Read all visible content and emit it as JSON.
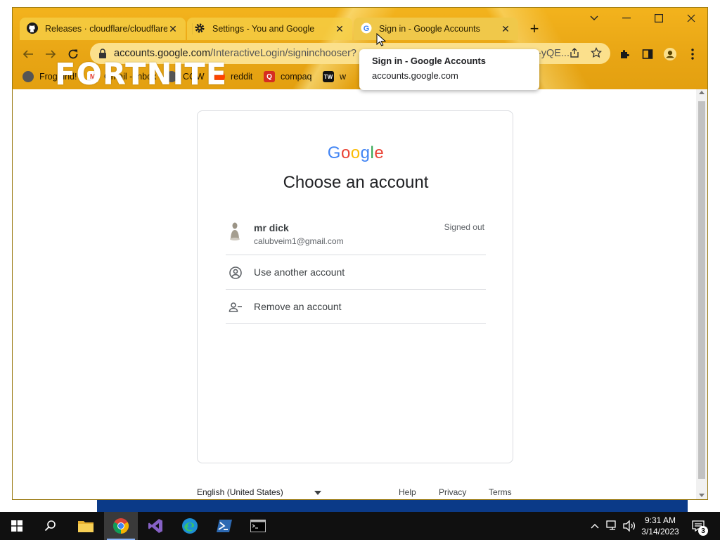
{
  "browser": {
    "tabs": [
      {
        "label": "Releases · cloudflare/cloudflared",
        "icon": "github-icon",
        "active": false
      },
      {
        "label": "Settings - You and Google",
        "icon": "gear-icon",
        "active": false
      },
      {
        "label": "Sign in - Google Accounts",
        "icon": "google-g-icon",
        "active": true
      }
    ],
    "close_glyph": "✕",
    "new_tab_glyph": "+",
    "window_controls": {
      "dropdown": "⌄",
      "minimize": "—",
      "maximize": "☐",
      "close": "✕"
    },
    "address": {
      "domain": "accounts.google.com",
      "path": "/InteractiveLogin/signinchooser?",
      "tail": "-yQE..."
    },
    "bookmarks": [
      {
        "label": "FrogFind!",
        "icon": "globe-icon",
        "color": "#555555"
      },
      {
        "label": "Gmail - Inbox",
        "icon": "gmail-icon",
        "color": "#ea4335"
      },
      {
        "label": "COW",
        "icon": "globe-icon",
        "color": "#555555"
      },
      {
        "label": "reddit",
        "icon": "reddit-icon",
        "color": "#ff4500"
      },
      {
        "label": "compaq",
        "icon": "compaq-icon",
        "color": "#d62d20"
      },
      {
        "label": "w",
        "icon": "tw-icon",
        "color": "#111111"
      }
    ],
    "theme_logo_text": "FORTNITE",
    "tooltip": {
      "title": "Sign in - Google Accounts",
      "subtitle": "accounts.google.com"
    }
  },
  "page": {
    "logo_letters": [
      {
        "ch": "G",
        "color": "#4285f4"
      },
      {
        "ch": "o",
        "color": "#ea4335"
      },
      {
        "ch": "o",
        "color": "#fbbc05"
      },
      {
        "ch": "g",
        "color": "#4285f4"
      },
      {
        "ch": "l",
        "color": "#34a853"
      },
      {
        "ch": "e",
        "color": "#ea4335"
      }
    ],
    "title": "Choose an account",
    "account": {
      "name": "mr dick",
      "email": "calubveim1@gmail.com",
      "status": "Signed out"
    },
    "use_another": "Use another account",
    "remove": "Remove an account",
    "footer": {
      "language": "English (United States)",
      "help": "Help",
      "privacy": "Privacy",
      "terms": "Terms"
    }
  },
  "taskbar": {
    "time": "9:31 AM",
    "date": "3/14/2023",
    "notification_count": "3"
  }
}
